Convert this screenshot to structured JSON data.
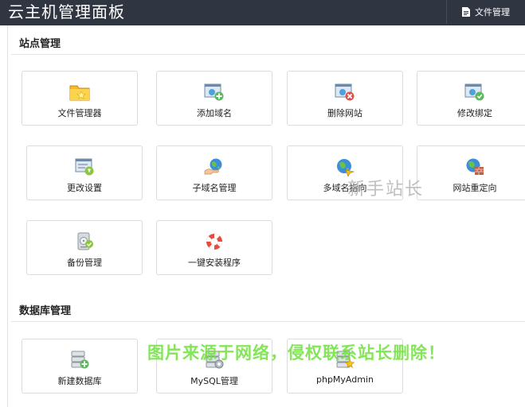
{
  "header": {
    "title": "云主机管理面板",
    "file_button_label": "文件管理"
  },
  "sections": {
    "site": {
      "title": "站点管理",
      "items": [
        {
          "label": "文件管理器",
          "icon": "folder-icon"
        },
        {
          "label": "添加域名",
          "icon": "add-domain-icon"
        },
        {
          "label": "删除网站",
          "icon": "delete-site-icon"
        },
        {
          "label": "修改绑定",
          "icon": "edit-binding-icon"
        },
        {
          "label": "更改设置",
          "icon": "settings-icon"
        },
        {
          "label": "子域名管理",
          "icon": "subdomain-icon"
        },
        {
          "label": "多域名指向",
          "icon": "multi-domain-icon"
        },
        {
          "label": "网站重定向",
          "icon": "redirect-icon"
        },
        {
          "label": "备份管理",
          "icon": "backup-icon"
        },
        {
          "label": "一键安装程序",
          "icon": "lifebuoy-icon"
        }
      ]
    },
    "database": {
      "title": "数据库管理",
      "items": [
        {
          "label": "新建数据库",
          "icon": "new-database-icon"
        },
        {
          "label": "MySQL管理",
          "icon": "mysql-icon"
        },
        {
          "label": "phpMyAdmin",
          "icon": "phpmyadmin-icon"
        }
      ]
    }
  },
  "watermarks": {
    "site_watermark": "新手站长",
    "source_notice": "图片来源于网络，侵权联系站长删除！"
  }
}
